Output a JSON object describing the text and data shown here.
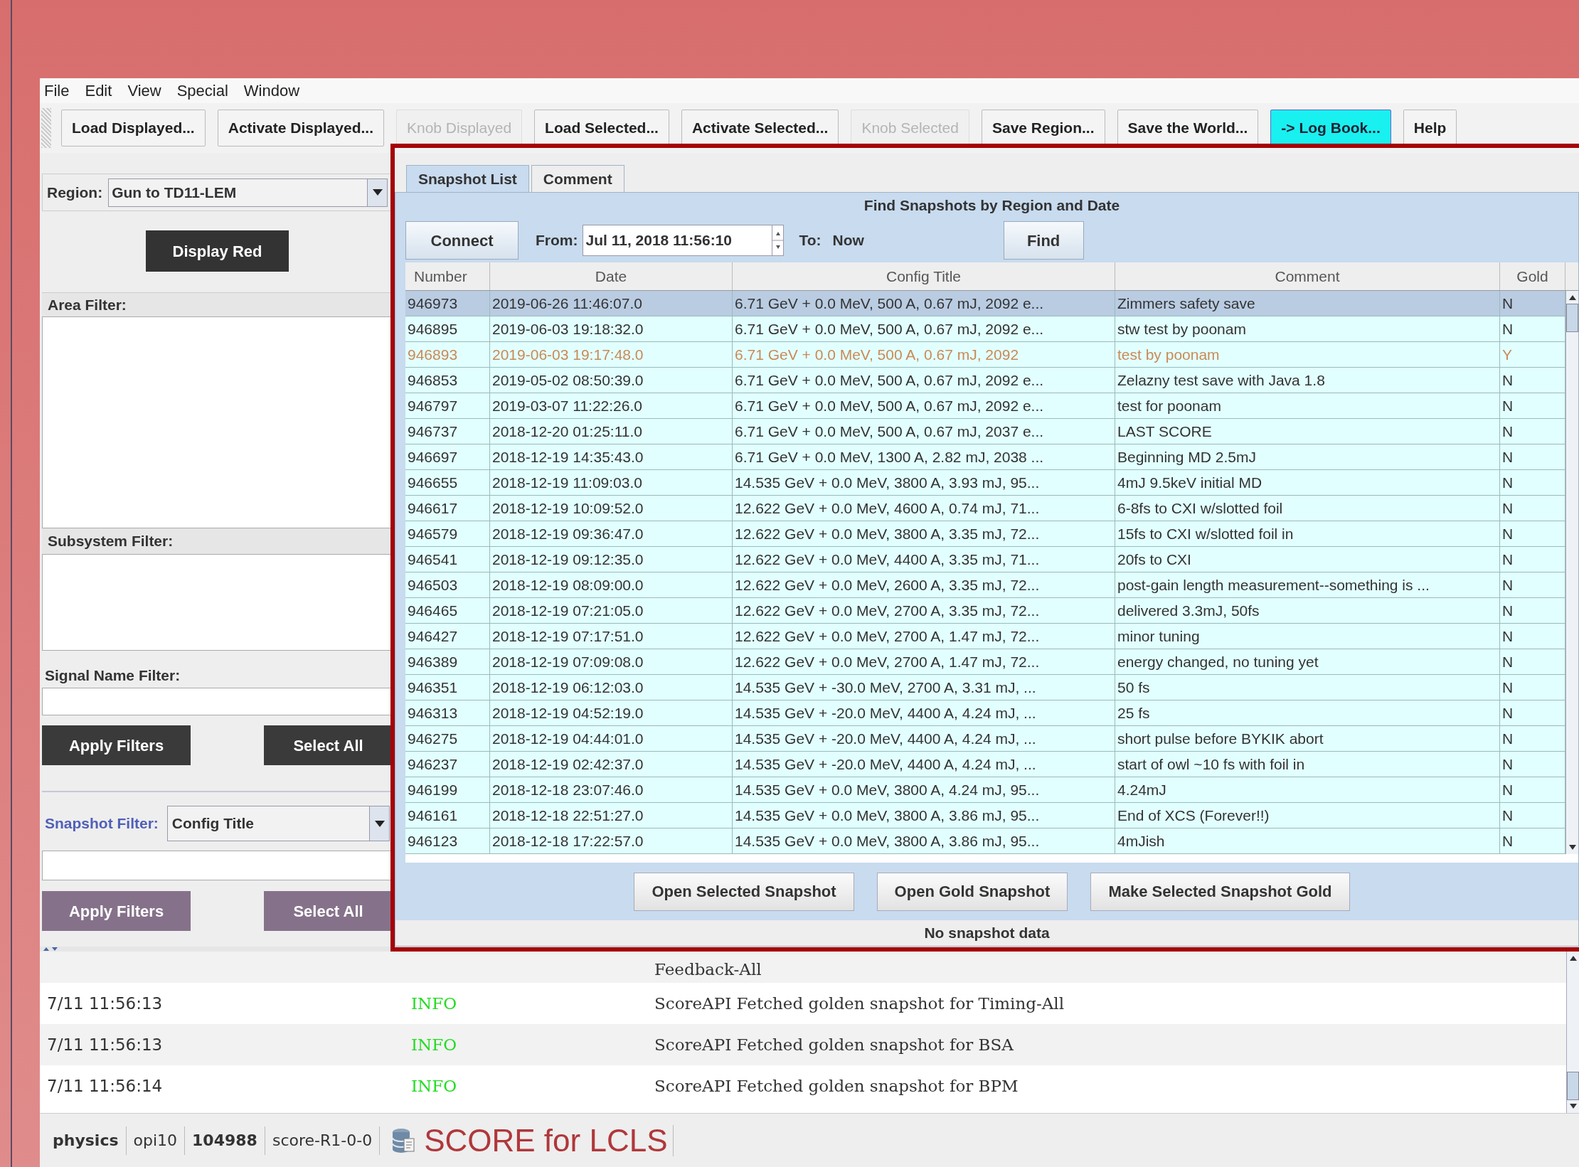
{
  "menu": [
    "File",
    "Edit",
    "View",
    "Special",
    "Window"
  ],
  "toolbar": [
    {
      "label": "Load Displayed...",
      "disabled": false,
      "highlighted": false
    },
    {
      "label": "Activate Displayed...",
      "disabled": false,
      "highlighted": false
    },
    {
      "label": "Knob Displayed",
      "disabled": true,
      "highlighted": false
    },
    {
      "label": "Load Selected...",
      "disabled": false,
      "highlighted": false
    },
    {
      "label": "Activate Selected...",
      "disabled": false,
      "highlighted": false
    },
    {
      "label": "Knob Selected",
      "disabled": true,
      "highlighted": false
    },
    {
      "label": "Save Region...",
      "disabled": false,
      "highlighted": false
    },
    {
      "label": "Save the World...",
      "disabled": false,
      "highlighted": false
    },
    {
      "label": "-> Log Book...",
      "disabled": false,
      "highlighted": true
    },
    {
      "label": "Help",
      "disabled": false,
      "highlighted": false
    }
  ],
  "left_panel": {
    "region_label": "Region:",
    "region_value": "Gun to TD11-LEM",
    "display_button": "Display Red",
    "area_filter_label": "Area Filter:",
    "subsystem_filter_label": "Subsystem Filter:",
    "signal_filter_label": "Signal Name Filter:",
    "filter_buttons": [
      "Apply Filters",
      "Select All"
    ],
    "snapshot_filter_label": "Snapshot Filter:",
    "snapshot_filter_value": "Config Title",
    "snapshot_buttons": [
      "Apply Filters",
      "Select All"
    ]
  },
  "tabs": [
    {
      "label": "Snapshot List",
      "selected": true
    },
    {
      "label": "Comment",
      "selected": false
    }
  ],
  "finder": {
    "title": "Find Snapshots by Region and Date",
    "connect": "Connect",
    "from_label": "From:",
    "from_value": "Jul 11, 2018 11:56:10",
    "to_label": "To:",
    "to_value": "Now",
    "find": "Find"
  },
  "table": {
    "columns": [
      "Number",
      "Date",
      "Config Title",
      "Comment",
      "Gold"
    ],
    "rows": [
      {
        "cells": [
          "946973",
          "2019-06-26 11:46:07.0",
          "6.71 GeV + 0.0 MeV, 500 A, 0.67 mJ, 2092 e...",
          "Zimmers safety save",
          "N"
        ],
        "selected": true,
        "golden": false
      },
      {
        "cells": [
          "946895",
          "2019-06-03 19:18:32.0",
          "6.71 GeV + 0.0 MeV, 500 A, 0.67 mJ, 2092 e...",
          "stw test by poonam",
          "N"
        ],
        "selected": false,
        "golden": false
      },
      {
        "cells": [
          "946893",
          "2019-06-03 19:17:48.0",
          "6.71 GeV + 0.0 MeV, 500 A, 0.67 mJ, 2092",
          "test by poonam",
          "Y"
        ],
        "selected": false,
        "golden": true
      },
      {
        "cells": [
          "946853",
          "2019-05-02 08:50:39.0",
          "6.71 GeV + 0.0 MeV, 500 A, 0.67 mJ, 2092 e...",
          "Zelazny test save with Java 1.8",
          "N"
        ],
        "selected": false,
        "golden": false
      },
      {
        "cells": [
          "946797",
          "2019-03-07 11:22:26.0",
          "6.71 GeV + 0.0 MeV, 500 A, 0.67 mJ, 2092 e...",
          "test for poonam",
          "N"
        ],
        "selected": false,
        "golden": false
      },
      {
        "cells": [
          "946737",
          "2018-12-20 01:25:11.0",
          "6.71 GeV + 0.0 MeV, 500 A, 0.67 mJ, 2037 e...",
          "LAST SCORE",
          "N"
        ],
        "selected": false,
        "golden": false
      },
      {
        "cells": [
          "946697",
          "2018-12-19 14:35:43.0",
          "6.71 GeV + 0.0 MeV, 1300 A, 2.82 mJ, 2038 ...",
          "Beginning MD 2.5mJ",
          "N"
        ],
        "selected": false,
        "golden": false
      },
      {
        "cells": [
          "946655",
          "2018-12-19 11:09:03.0",
          "14.535 GeV + 0.0 MeV, 3800 A, 3.93 mJ, 95...",
          "4mJ 9.5keV initial MD",
          "N"
        ],
        "selected": false,
        "golden": false
      },
      {
        "cells": [
          "946617",
          "2018-12-19 10:09:52.0",
          "12.622 GeV + 0.0 MeV, 4600 A, 0.74 mJ, 71...",
          "6-8fs to CXI w/slotted foil",
          "N"
        ],
        "selected": false,
        "golden": false
      },
      {
        "cells": [
          "946579",
          "2018-12-19 09:36:47.0",
          "12.622 GeV + 0.0 MeV, 3800 A, 3.35 mJ, 72...",
          "15fs to CXI w/slotted foil in",
          "N"
        ],
        "selected": false,
        "golden": false
      },
      {
        "cells": [
          "946541",
          "2018-12-19 09:12:35.0",
          "12.622 GeV + 0.0 MeV, 4400 A, 3.35 mJ, 71...",
          "20fs to CXI",
          "N"
        ],
        "selected": false,
        "golden": false
      },
      {
        "cells": [
          "946503",
          "2018-12-19 08:09:00.0",
          "12.622 GeV + 0.0 MeV, 2600 A, 3.35 mJ, 72...",
          "post-gain length measurement--something is ...",
          "N"
        ],
        "selected": false,
        "golden": false
      },
      {
        "cells": [
          "946465",
          "2018-12-19 07:21:05.0",
          "12.622 GeV + 0.0 MeV, 2700 A, 3.35 mJ, 72...",
          "delivered 3.3mJ, 50fs",
          "N"
        ],
        "selected": false,
        "golden": false
      },
      {
        "cells": [
          "946427",
          "2018-12-19 07:17:51.0",
          "12.622 GeV + 0.0 MeV, 2700 A, 1.47 mJ, 72...",
          "minor tuning",
          "N"
        ],
        "selected": false,
        "golden": false
      },
      {
        "cells": [
          "946389",
          "2018-12-19 07:09:08.0",
          "12.622 GeV + 0.0 MeV, 2700 A, 1.47 mJ, 72...",
          "energy changed, no tuning yet",
          "N"
        ],
        "selected": false,
        "golden": false
      },
      {
        "cells": [
          "946351",
          "2018-12-19 06:12:03.0",
          "14.535 GeV + -30.0 MeV, 2700 A, 3.31 mJ, ...",
          "50 fs",
          "N"
        ],
        "selected": false,
        "golden": false
      },
      {
        "cells": [
          "946313",
          "2018-12-19 04:52:19.0",
          "14.535 GeV + -20.0 MeV, 4400 A, 4.24 mJ, ...",
          "25 fs",
          "N"
        ],
        "selected": false,
        "golden": false
      },
      {
        "cells": [
          "946275",
          "2018-12-19 04:44:01.0",
          "14.535 GeV + -20.0 MeV, 4400 A, 4.24 mJ, ...",
          "short pulse before BYKIK abort",
          "N"
        ],
        "selected": false,
        "golden": false
      },
      {
        "cells": [
          "946237",
          "2018-12-19 02:42:37.0",
          "14.535 GeV + -20.0 MeV, 4400 A, 4.24 mJ, ...",
          "start of owl ~10 fs with foil in",
          "N"
        ],
        "selected": false,
        "golden": false
      },
      {
        "cells": [
          "946199",
          "2018-12-18 23:07:46.0",
          "14.535 GeV + 0.0 MeV, 3800 A, 4.24 mJ, 95...",
          "4.24mJ",
          "N"
        ],
        "selected": false,
        "golden": false
      },
      {
        "cells": [
          "946161",
          "2018-12-18 22:51:27.0",
          "14.535 GeV + 0.0 MeV, 3800 A, 3.86 mJ, 95...",
          "End of XCS (Forever!!)",
          "N"
        ],
        "selected": false,
        "golden": false
      },
      {
        "cells": [
          "946123",
          "2018-12-18 17:22:57.0",
          "14.535 GeV + 0.0 MeV, 3800 A, 3.86 mJ, 95...",
          "4mJish",
          "N"
        ],
        "selected": false,
        "golden": false
      }
    ]
  },
  "actions": [
    "Open Selected Snapshot",
    "Open Gold Snapshot",
    "Make Selected Snapshot Gold"
  ],
  "status": "No snapshot data",
  "log": [
    {
      "message": "Feedback-All"
    },
    {
      "time": "7/11 11:56:13",
      "severity": "INFO",
      "message": "ScoreAPI Fetched golden snapshot for Timing-All"
    },
    {
      "time": "7/11 11:56:13",
      "severity": "INFO",
      "message": "ScoreAPI Fetched golden snapshot for BSA"
    },
    {
      "time": "7/11 11:56:14",
      "severity": "INFO",
      "message": "ScoreAPI Fetched golden snapshot for BPM"
    }
  ],
  "status_bar": {
    "items": [
      {
        "text": "physics",
        "bold": true
      },
      {
        "text": "opi10",
        "bold": false
      },
      {
        "text": "104988",
        "bold": true
      },
      {
        "text": "score-R1-0-0",
        "bold": false
      }
    ],
    "app_title": "SCORE for LCLS"
  }
}
